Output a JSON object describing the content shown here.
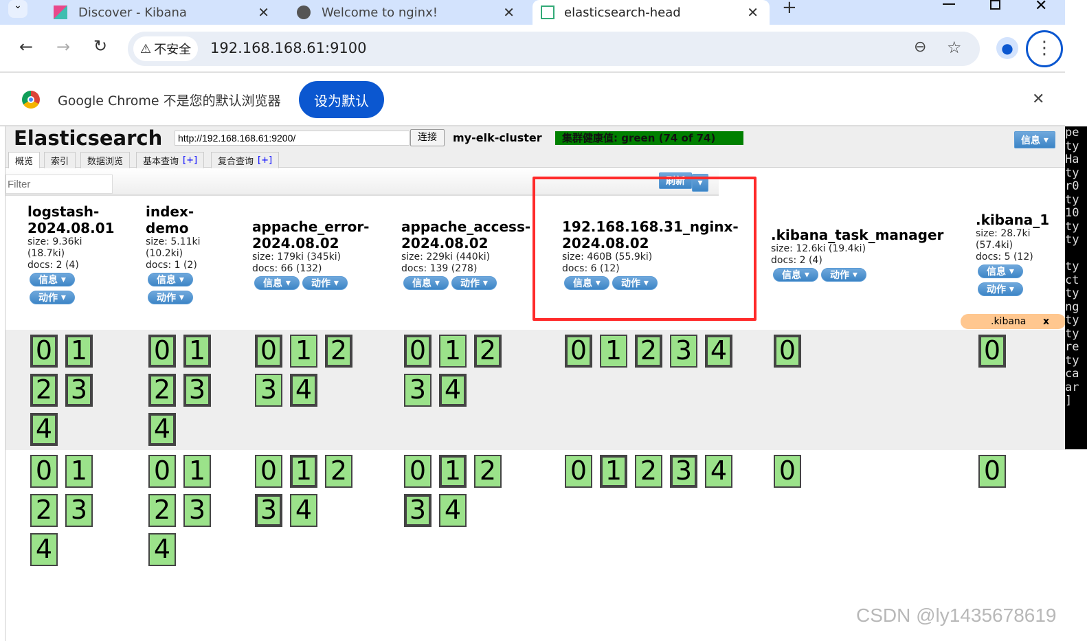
{
  "browser": {
    "tabs": [
      {
        "title": "Discover - Kibana"
      },
      {
        "title": "Welcome to nginx!"
      },
      {
        "title": "elasticsearch-head"
      }
    ],
    "security_chip": "不安全",
    "url": "192.168.168.61:9100",
    "infobar_text": "Google Chrome 不是您的默认浏览器",
    "infobar_button": "设为默认"
  },
  "app": {
    "title": "Elasticsearch",
    "connect_url": "http://192.168.168.61:9200/",
    "connect_label": "连接",
    "cluster_name": "my-elk-cluster",
    "health": "集群健康值: green (74 of 74)",
    "info_label": "信息",
    "tabs": [
      {
        "label": "概览",
        "plus": ""
      },
      {
        "label": "索引",
        "plus": ""
      },
      {
        "label": "数据浏览",
        "plus": ""
      },
      {
        "label": "基本查询",
        "plus": "[+]"
      },
      {
        "label": "复合查询",
        "plus": "[+]"
      }
    ],
    "filter_placeholder": "Filter",
    "refresh_label": "刷新",
    "info_btn": "信息",
    "action_btn": "动作",
    "alias_label": ".kibana",
    "alias_close": "x",
    "watermark": "CSDN @ly1435678619",
    "colors": {
      "health": "#008000",
      "shard": "#9be28a",
      "highlight": "#ff2a2a",
      "alias": "#ffc78f"
    }
  },
  "indices": [
    {
      "name": "logstash-\n2024.08.01",
      "size": "size: 9.36ki\n(18.7ki)",
      "docs": "docs: 2 (4)",
      "stack": true,
      "node1": [
        1,
        1,
        1,
        1,
        1
      ],
      "node2": [
        0,
        0,
        0,
        0,
        0
      ]
    },
    {
      "name": "index-\ndemo",
      "size": "size: 5.11ki\n(10.2ki)",
      "docs": "docs: 1 (2)",
      "stack": true,
      "node1": [
        1,
        1,
        1,
        1,
        1
      ],
      "node2": [
        0,
        0,
        0,
        0,
        0
      ]
    },
    {
      "name": "appache_error-\n2024.08.02",
      "size": "size: 179ki (345ki)",
      "docs": "docs: 66 (132)",
      "stack": false,
      "node1": [
        1,
        0,
        1,
        0,
        1
      ],
      "node2": [
        0,
        1,
        0,
        1,
        0
      ]
    },
    {
      "name": "appache_access-\n2024.08.02",
      "size": "size: 229ki (440ki)",
      "docs": "docs: 139 (278)",
      "stack": false,
      "node1": [
        1,
        0,
        1,
        0,
        1
      ],
      "node2": [
        0,
        1,
        0,
        1,
        0
      ]
    },
    {
      "name": "192.168.168.31_nginx-\n2024.08.02",
      "size": "size: 460B (55.9ki)",
      "docs": "docs: 6 (12)",
      "stack": false,
      "highlighted": true,
      "node1": [
        1,
        0,
        1,
        0,
        1
      ],
      "node2": [
        0,
        1,
        0,
        1,
        0
      ]
    },
    {
      "name": ".kibana_task_manager",
      "size": "size: 12.6ki (19.4ki)",
      "docs": "docs: 2 (4)",
      "stack": false,
      "node1": [
        1
      ],
      "node2": [
        0
      ]
    },
    {
      "name": ".kibana_1",
      "size": "size: 28.7ki\n(57.4ki)",
      "docs": "docs: 5 (12)",
      "stack": true,
      "node1": [
        1
      ],
      "node2": [
        0
      ]
    }
  ],
  "terminal_fragments": [
    "pe",
    "ty",
    "Ha",
    "ty",
    "r0",
    "ty",
    "10",
    "ty",
    "ty",
    "",
    "ty",
    "ct",
    "ty",
    "ng",
    "ty",
    "ty",
    "re",
    "ty",
    "ca",
    "ar",
    "]"
  ]
}
